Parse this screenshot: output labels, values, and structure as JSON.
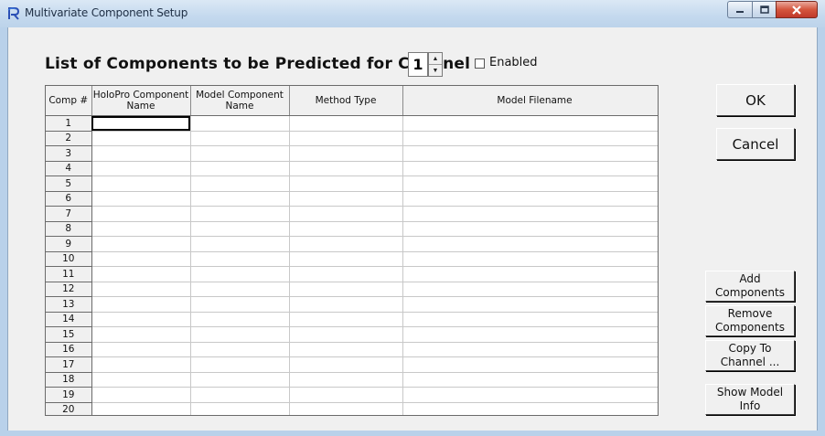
{
  "window": {
    "title": "Multivariate Component Setup",
    "icon": "r-app-icon"
  },
  "heading": {
    "text": "List of Components to be Predicted for Channel"
  },
  "channel_spinner": {
    "value": "1"
  },
  "enabled_checkbox": {
    "label": "Enabled",
    "checked": false
  },
  "grid": {
    "headers": {
      "comp": "Comp #",
      "holopro": "HoloPro Component Name",
      "model": "Model Component Name",
      "method": "Method Type",
      "filename": "Model Filename"
    },
    "rows": [
      "1",
      "2",
      "3",
      "4",
      "5",
      "6",
      "7",
      "8",
      "9",
      "10",
      "11",
      "12",
      "13",
      "14",
      "15",
      "16",
      "17",
      "18",
      "19",
      "20"
    ]
  },
  "buttons": {
    "ok": "OK",
    "cancel": "Cancel",
    "add": "Add Components",
    "remove": "Remove Components",
    "copy": "Copy To Channel ...",
    "info": "Show Model Info"
  }
}
